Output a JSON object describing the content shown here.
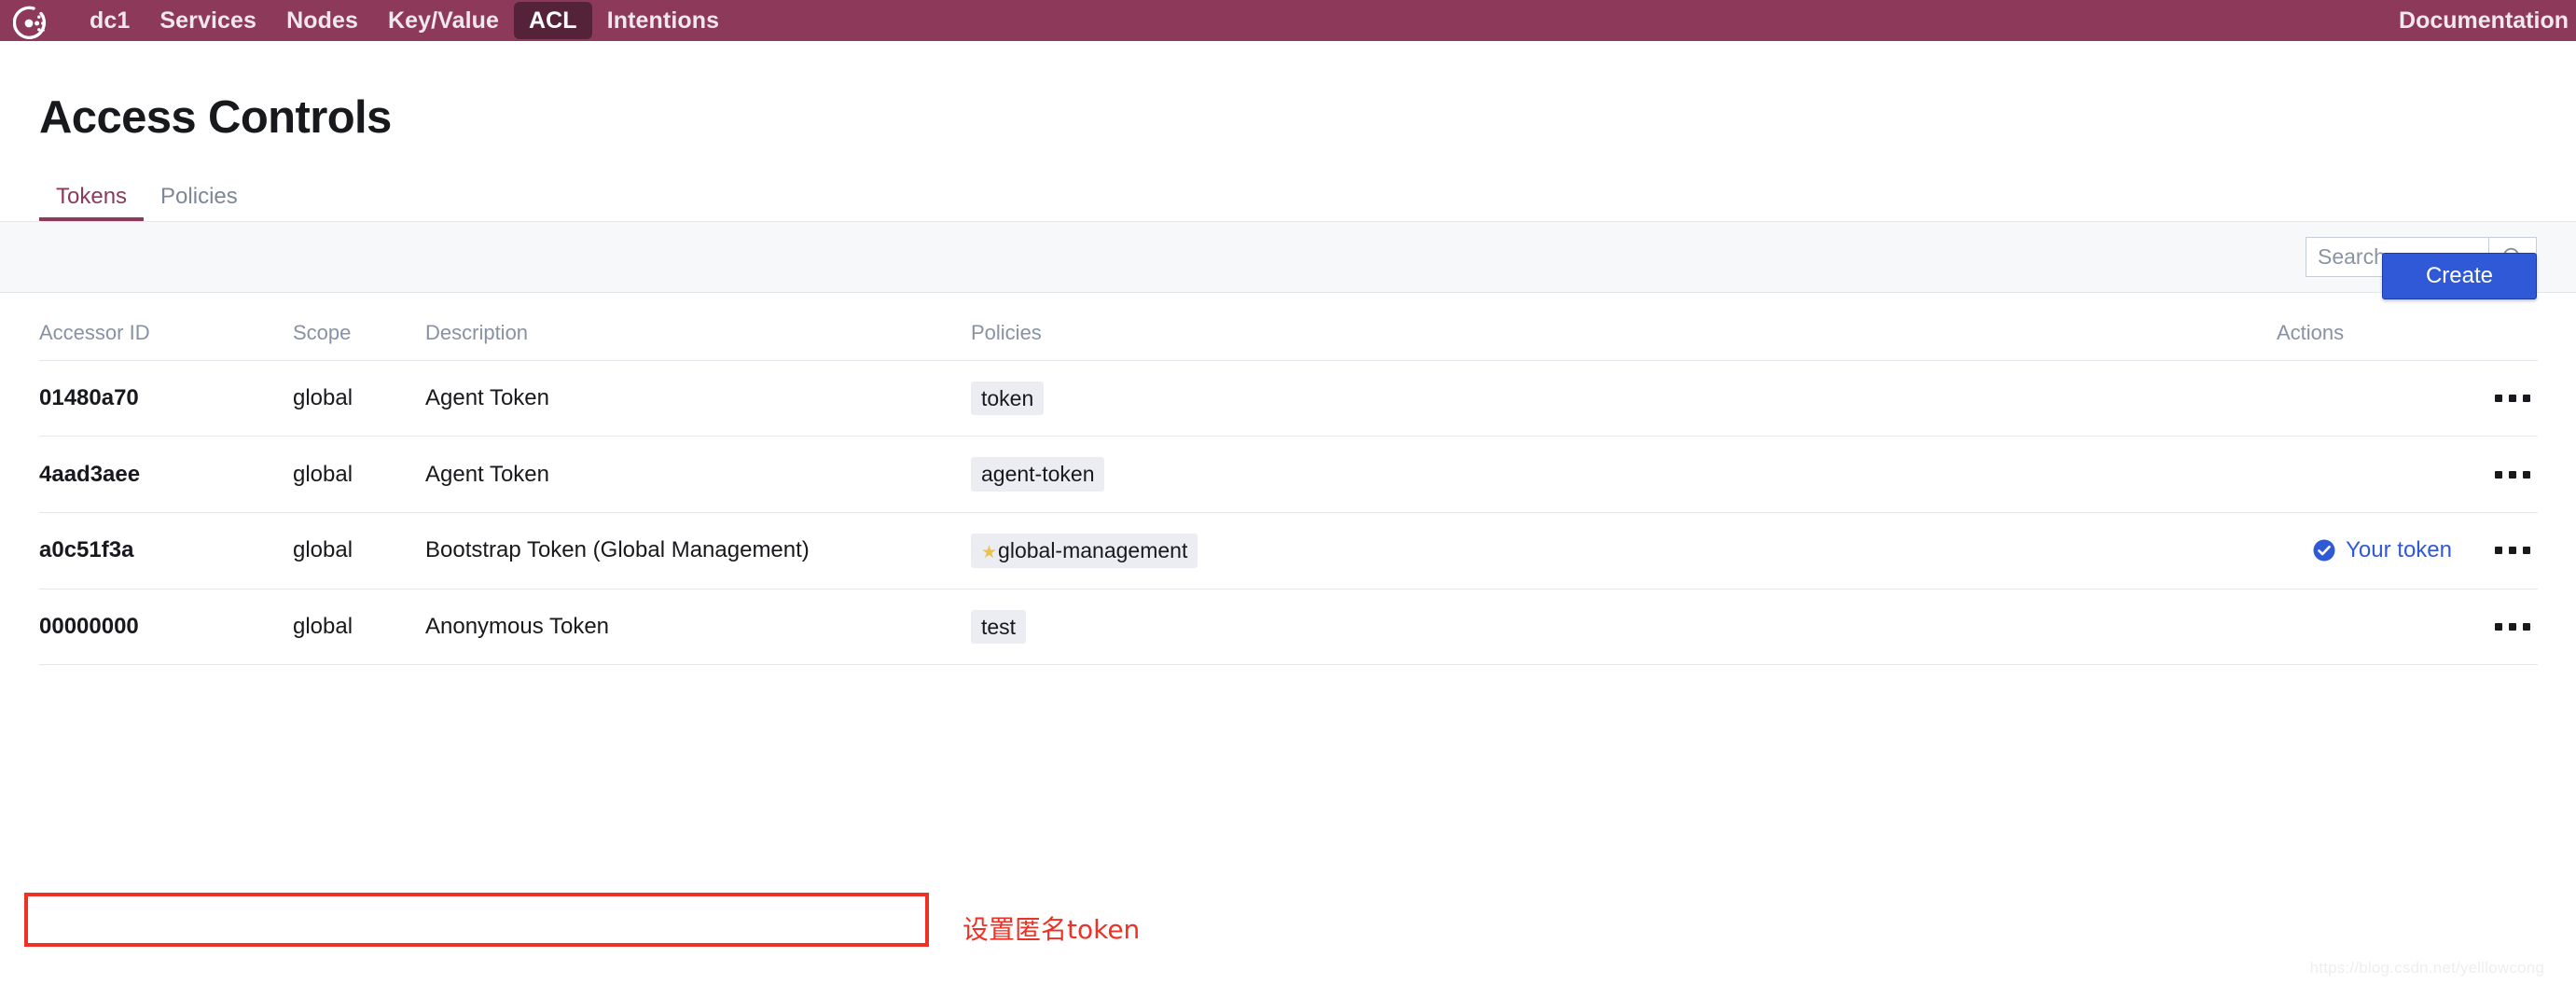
{
  "navbar": {
    "logo_icon": "consul-logo-icon",
    "items": [
      {
        "label": "dc1",
        "active": false
      },
      {
        "label": "Services",
        "active": false
      },
      {
        "label": "Nodes",
        "active": false
      },
      {
        "label": "Key/Value",
        "active": false
      },
      {
        "label": "ACL",
        "active": true
      },
      {
        "label": "Intentions",
        "active": false
      }
    ],
    "right_link": "Documentation",
    "background_color": "#8c395a",
    "active_background_color": "#54233a"
  },
  "page": {
    "title": "Access Controls"
  },
  "tabs": [
    {
      "label": "Tokens",
      "active": true
    },
    {
      "label": "Policies",
      "active": false
    }
  ],
  "toolbar": {
    "create_label": "Create",
    "create_color": "#3059d7"
  },
  "search": {
    "placeholder": "Search",
    "value": "",
    "icon": "search-icon"
  },
  "table": {
    "columns": [
      "Accessor ID",
      "Scope",
      "Description",
      "Policies",
      "Actions"
    ],
    "rows": [
      {
        "accessor_id": "01480a70",
        "scope": "global",
        "description": "Agent Token",
        "policy": "token",
        "policy_starred": false,
        "your_token": false,
        "your_token_label": "",
        "actions_icon": "ellipsis-icon",
        "highlighted": false
      },
      {
        "accessor_id": "4aad3aee",
        "scope": "global",
        "description": "Agent Token",
        "policy": "agent-token",
        "policy_starred": false,
        "your_token": false,
        "your_token_label": "",
        "actions_icon": "ellipsis-icon",
        "highlighted": false
      },
      {
        "accessor_id": "a0c51f3a",
        "scope": "global",
        "description": "Bootstrap Token (Global Management)",
        "policy": "global-management",
        "policy_starred": true,
        "your_token": true,
        "your_token_label": "Your token",
        "actions_icon": "ellipsis-icon",
        "highlighted": false
      },
      {
        "accessor_id": "00000000",
        "scope": "global",
        "description": "Anonymous Token",
        "policy": "test",
        "policy_starred": false,
        "your_token": false,
        "your_token_label": "",
        "actions_icon": "ellipsis-icon",
        "highlighted": true
      }
    ]
  },
  "annotations": {
    "note_text": "设置匿名token",
    "note_color": "#ee3124",
    "highlight_color": "#ee3124",
    "watermark": "https://blog.csdn.net/yelllowcong"
  }
}
